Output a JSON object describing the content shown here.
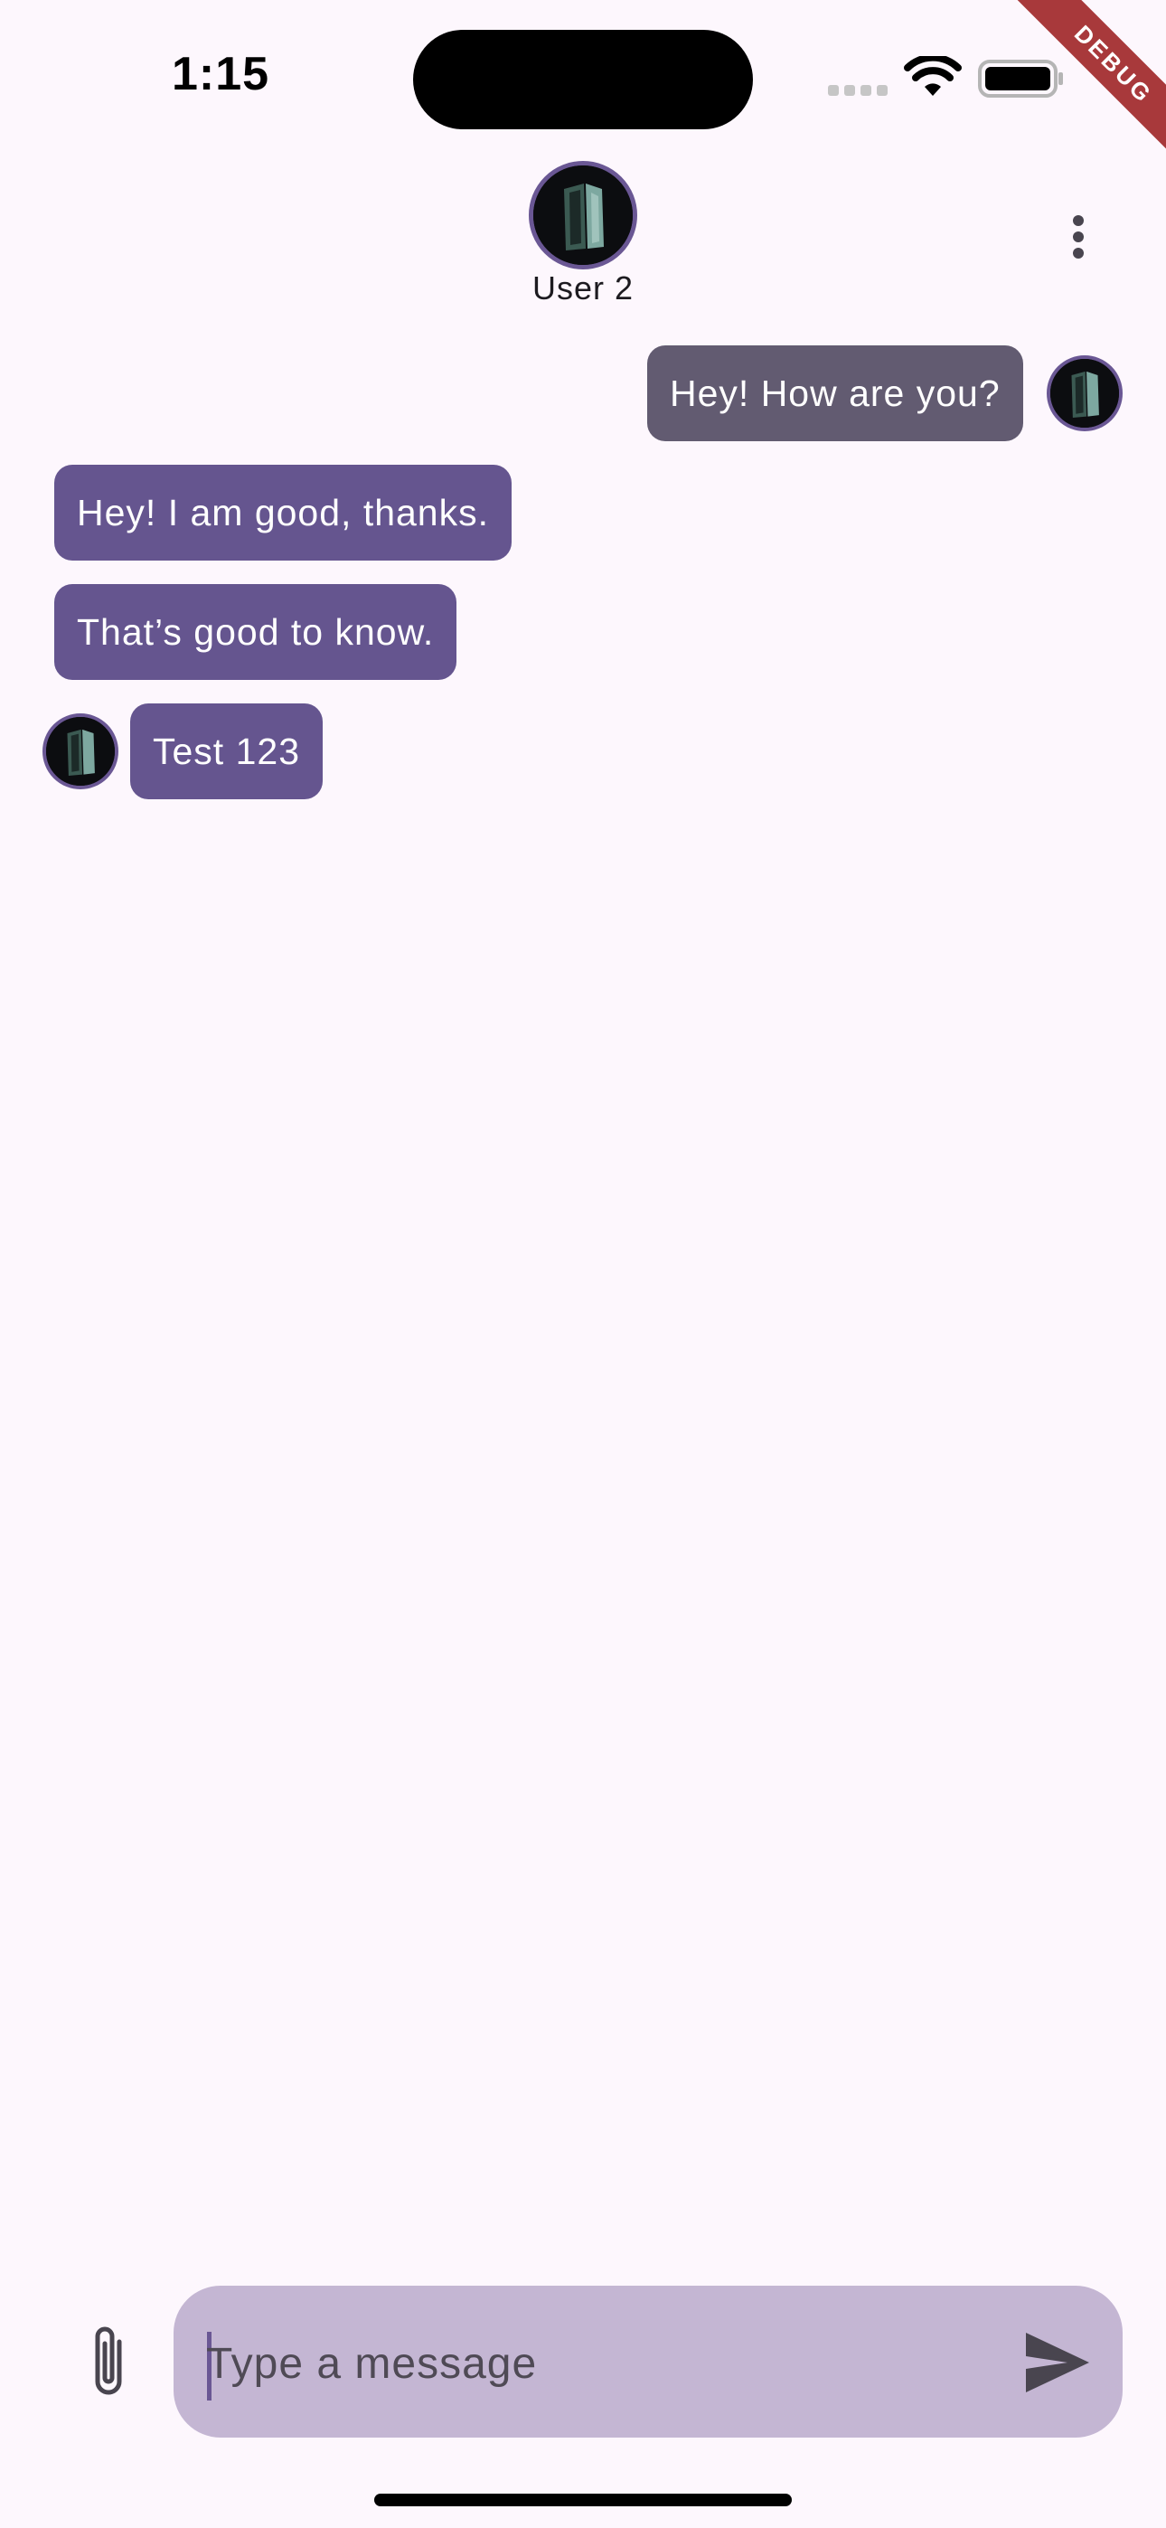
{
  "status_bar": {
    "time": "1:15",
    "debug_label": "DEBUG"
  },
  "header": {
    "contact_name": "User 2",
    "avatar_icon": "user-avatar",
    "menu_icon": "more-vert-icon"
  },
  "messages": [
    {
      "text": "Hey! How are you?",
      "direction": "sent"
    },
    {
      "text": "Hey! I am good, thanks.",
      "direction": "received"
    },
    {
      "text": "That’s good to know.",
      "direction": "received"
    },
    {
      "text": "Test 123",
      "direction": "received"
    }
  ],
  "composer": {
    "placeholder": "Type a message",
    "value": "",
    "attach_icon": "paperclip-icon",
    "send_icon": "send-icon"
  },
  "colors": {
    "background": "#fdf7fd",
    "sent_bubble": "#625b71",
    "received_bubble": "#65558f",
    "input_background": "#c4b6d3",
    "avatar_ring": "#6a5794",
    "debug_banner": "#a8393b"
  }
}
